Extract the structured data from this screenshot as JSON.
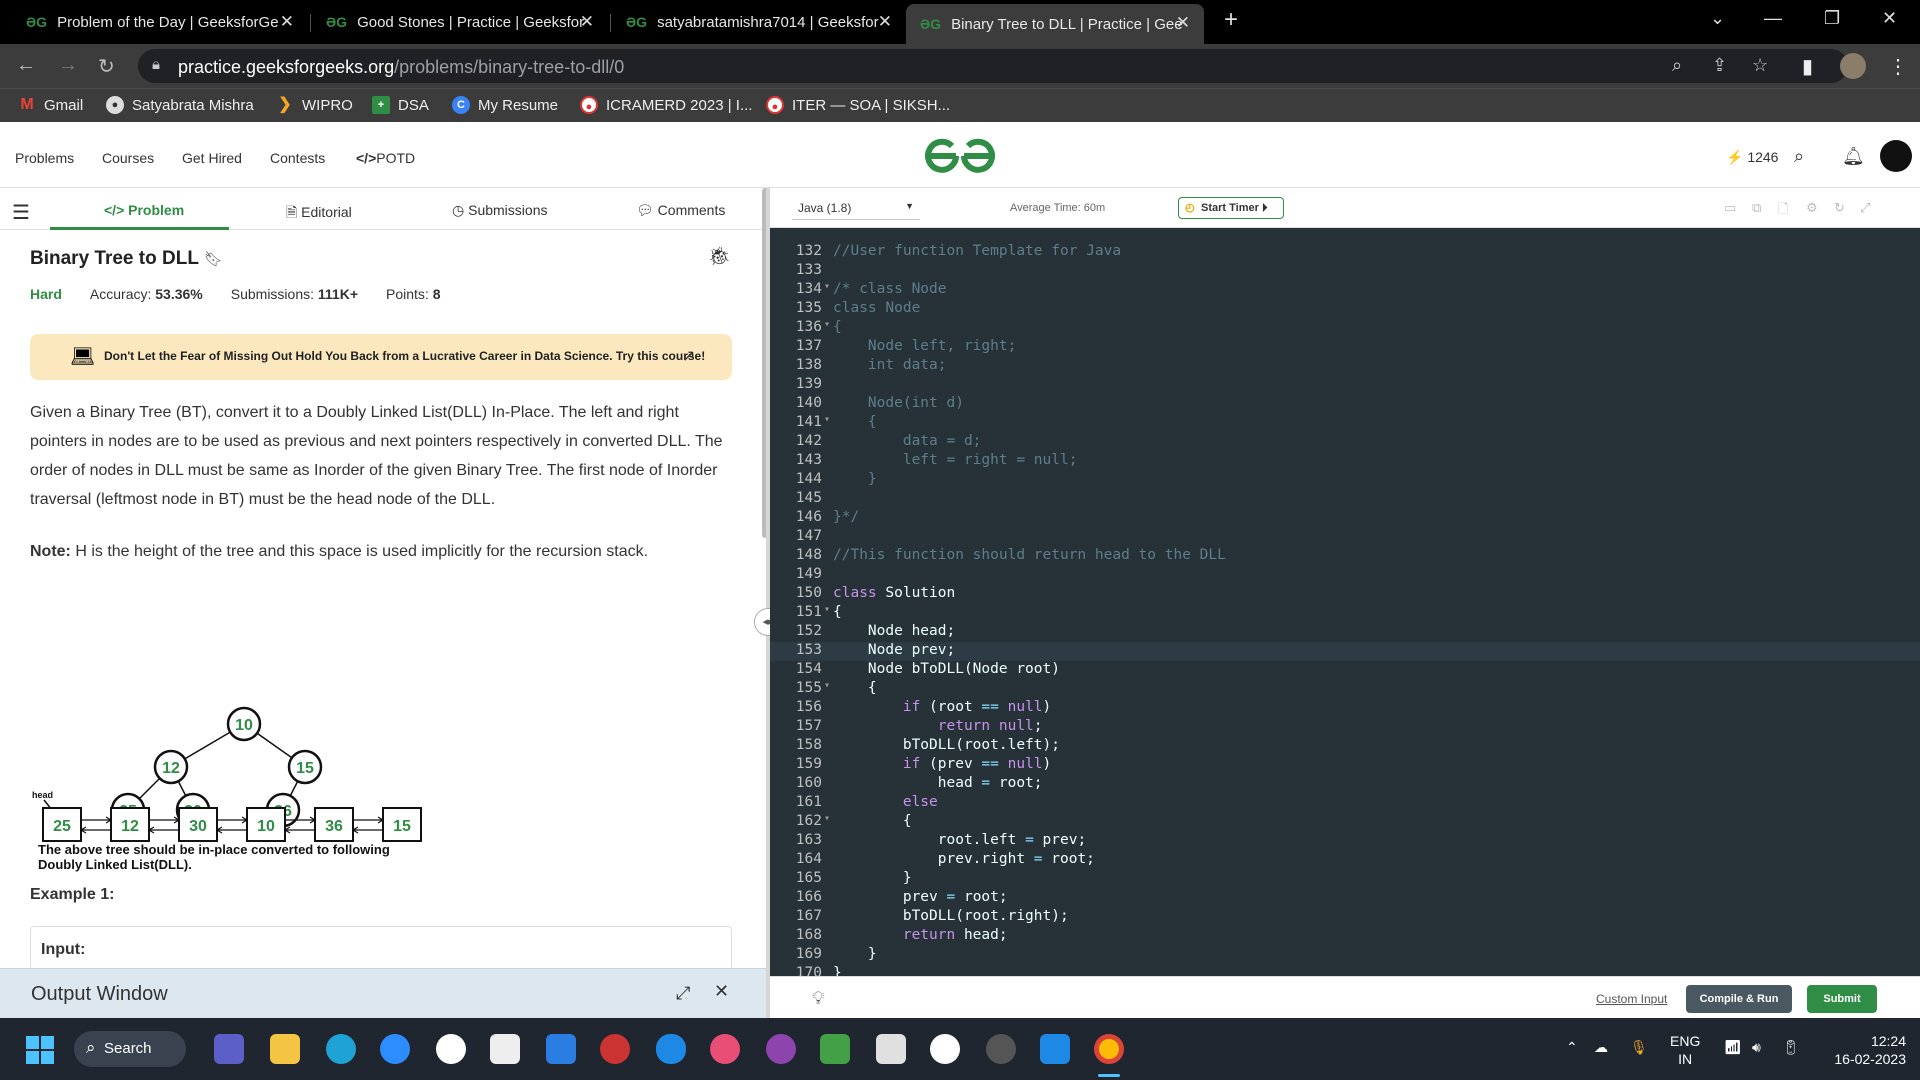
{
  "browser": {
    "tabs": [
      {
        "title": "Problem of the Day | GeeksforGe"
      },
      {
        "title": "Good Stones | Practice | Geeksfor"
      },
      {
        "title": "satyabratamishra7014 | Geeksfor"
      },
      {
        "title": "Binary Tree to DLL | Practice | Gee"
      }
    ],
    "url_host": "practice.geeksforgeeks.org",
    "url_path": "/problems/binary-tree-to-dll/0",
    "bookmarks": [
      {
        "label": "Gmail",
        "icon": "gmail-icon"
      },
      {
        "label": "Satyabrata Mishra",
        "icon": "profile-icon"
      },
      {
        "label": "WIPRO",
        "icon": "chevron-icon"
      },
      {
        "label": "DSA",
        "icon": "plus-icon"
      },
      {
        "label": "My Resume",
        "icon": "c-icon"
      },
      {
        "label": "ICRAMERD 2023 | I...",
        "icon": "site-icon"
      },
      {
        "label": "ITER — SOA | SIKSH...",
        "icon": "site-icon"
      }
    ]
  },
  "site_nav": {
    "links": [
      "Problems",
      "Courses",
      "Get Hired",
      "Contests",
      "POTD"
    ],
    "potd_prefix": "</>",
    "streak": "1246"
  },
  "problem_tabs": {
    "problem": "Problem",
    "editorial": "Editorial",
    "submissions": "Submissions",
    "comments": "Comments"
  },
  "problem": {
    "title": "Binary Tree to DLL",
    "difficulty": "Hard",
    "accuracy_label": "Accuracy:",
    "accuracy": "53.36%",
    "submissions_label": "Submissions:",
    "submissions": "111K+",
    "points_label": "Points:",
    "points": "8",
    "banner": "Don't Let the Fear of Missing Out Hold You Back from a Lucrative Career in Data Science. Try this course!",
    "description": "Given a Binary Tree (BT), convert it to a Doubly Linked List(DLL) In-Place. The left and right pointers in nodes are to be used as previous and next pointers respectively in converted DLL. The order of nodes in DLL must be same as Inorder of the given Binary Tree. The first node of Inorder traversal (leftmost node in BT) must be the head node of the DLL.",
    "note_label": "Note:",
    "note": " H is the height of the tree and this space is used implicitly for the recursion stack.",
    "tree_nodes": [
      "10",
      "12",
      "15",
      "25",
      "30",
      "36"
    ],
    "tree_caption_1": "The above tree should be in-place converted to following",
    "tree_caption_2": "Doubly Linked List(DLL).",
    "head_label": "head",
    "dll_nodes": [
      "25",
      "12",
      "30",
      "10",
      "36",
      "15"
    ],
    "example_title": "Example 1:",
    "input_label": "Input:"
  },
  "output_window": {
    "label": "Output Window"
  },
  "editor": {
    "language": "Java (1.8)",
    "avg_time": "Average Time: 60m",
    "start_timer": "Start Timer",
    "custom_input": "Custom Input",
    "compile_run": "Compile & Run",
    "submit": "Submit",
    "lines": [
      {
        "n": "132",
        "fold": "",
        "tokens": [
          [
            "c-com",
            "//User function Template for Java"
          ]
        ]
      },
      {
        "n": "133",
        "fold": "",
        "tokens": []
      },
      {
        "n": "134",
        "fold": "▾",
        "tokens": [
          [
            "c-com",
            "/* class Node"
          ]
        ]
      },
      {
        "n": "135",
        "fold": "",
        "tokens": [
          [
            "c-com",
            "class Node"
          ]
        ]
      },
      {
        "n": "136",
        "fold": "▾",
        "tokens": [
          [
            "c-com",
            "{"
          ]
        ]
      },
      {
        "n": "137",
        "fold": "",
        "tokens": [
          [
            "c-com",
            "    Node left, right;"
          ]
        ]
      },
      {
        "n": "138",
        "fold": "",
        "tokens": [
          [
            "c-com",
            "    int data;"
          ]
        ]
      },
      {
        "n": "139",
        "fold": "",
        "tokens": []
      },
      {
        "n": "140",
        "fold": "",
        "tokens": [
          [
            "c-com",
            "    Node(int d)"
          ]
        ]
      },
      {
        "n": "141",
        "fold": "▾",
        "tokens": [
          [
            "c-com",
            "    {"
          ]
        ]
      },
      {
        "n": "142",
        "fold": "",
        "tokens": [
          [
            "c-com",
            "        data = d;"
          ]
        ]
      },
      {
        "n": "143",
        "fold": "",
        "tokens": [
          [
            "c-com",
            "        left = right = null;"
          ]
        ]
      },
      {
        "n": "144",
        "fold": "",
        "tokens": [
          [
            "c-com",
            "    }"
          ]
        ]
      },
      {
        "n": "145",
        "fold": "",
        "tokens": []
      },
      {
        "n": "146",
        "fold": "",
        "tokens": [
          [
            "c-com",
            "}*/"
          ]
        ]
      },
      {
        "n": "147",
        "fold": "",
        "tokens": []
      },
      {
        "n": "148",
        "fold": "",
        "tokens": [
          [
            "c-com",
            "//This function should return head to the DLL"
          ]
        ]
      },
      {
        "n": "149",
        "fold": "",
        "tokens": []
      },
      {
        "n": "150",
        "fold": "",
        "tokens": [
          [
            "c-kw",
            "class"
          ],
          [
            "c-id",
            " Solution"
          ]
        ]
      },
      {
        "n": "151",
        "fold": "▾",
        "tokens": [
          [
            "c-id",
            "{"
          ]
        ]
      },
      {
        "n": "152",
        "fold": "",
        "tokens": [
          [
            "c-id",
            "    Node head;"
          ]
        ]
      },
      {
        "n": "153",
        "fold": "",
        "tokens": [
          [
            "c-id",
            "    Node prev;"
          ]
        ]
      },
      {
        "n": "154",
        "fold": "",
        "tokens": [
          [
            "c-id",
            "    Node bToDLL(Node root)"
          ]
        ]
      },
      {
        "n": "155",
        "fold": "▾",
        "tokens": [
          [
            "c-id",
            "    {"
          ]
        ]
      },
      {
        "n": "156",
        "fold": "",
        "tokens": [
          [
            "c-kw",
            "        if"
          ],
          [
            "c-id",
            " (root "
          ],
          [
            "c-op",
            "=="
          ],
          [
            "c-kw",
            " null"
          ],
          [
            "c-id",
            ")"
          ]
        ]
      },
      {
        "n": "157",
        "fold": "",
        "tokens": [
          [
            "c-kw",
            "            return null"
          ],
          [
            "c-id",
            ";"
          ]
        ]
      },
      {
        "n": "158",
        "fold": "",
        "tokens": [
          [
            "c-id",
            "        bToDLL(root.left);"
          ]
        ]
      },
      {
        "n": "159",
        "fold": "",
        "tokens": [
          [
            "c-kw",
            "        if"
          ],
          [
            "c-id",
            " (prev "
          ],
          [
            "c-op",
            "=="
          ],
          [
            "c-kw",
            " null"
          ],
          [
            "c-id",
            ")"
          ]
        ]
      },
      {
        "n": "160",
        "fold": "",
        "tokens": [
          [
            "c-id",
            "            head "
          ],
          [
            "c-op",
            "="
          ],
          [
            "c-id",
            " root;"
          ]
        ]
      },
      {
        "n": "161",
        "fold": "",
        "tokens": [
          [
            "c-kw",
            "        else"
          ]
        ]
      },
      {
        "n": "162",
        "fold": "▾",
        "tokens": [
          [
            "c-id",
            "        {"
          ]
        ]
      },
      {
        "n": "163",
        "fold": "",
        "tokens": [
          [
            "c-id",
            "            root.left "
          ],
          [
            "c-op",
            "="
          ],
          [
            "c-id",
            " prev;"
          ]
        ]
      },
      {
        "n": "164",
        "fold": "",
        "tokens": [
          [
            "c-id",
            "            prev.right "
          ],
          [
            "c-op",
            "="
          ],
          [
            "c-id",
            " root;"
          ]
        ]
      },
      {
        "n": "165",
        "fold": "",
        "tokens": [
          [
            "c-id",
            "        }"
          ]
        ]
      },
      {
        "n": "166",
        "fold": "",
        "tokens": [
          [
            "c-id",
            "        prev "
          ],
          [
            "c-op",
            "="
          ],
          [
            "c-id",
            " root;"
          ]
        ]
      },
      {
        "n": "167",
        "fold": "",
        "tokens": [
          [
            "c-id",
            "        bToDLL(root.right);"
          ]
        ]
      },
      {
        "n": "168",
        "fold": "",
        "tokens": [
          [
            "c-kw",
            "        return"
          ],
          [
            "c-id",
            " head;"
          ]
        ]
      },
      {
        "n": "169",
        "fold": "",
        "tokens": [
          [
            "c-id",
            "    }"
          ]
        ]
      },
      {
        "n": "170",
        "fold": "",
        "tokens": [
          [
            "c-id",
            "}"
          ]
        ]
      }
    ]
  },
  "taskbar": {
    "search": "Search",
    "lang_top": "ENG",
    "lang_bottom": "IN",
    "time": "12:24",
    "date": "16-02-2023"
  }
}
